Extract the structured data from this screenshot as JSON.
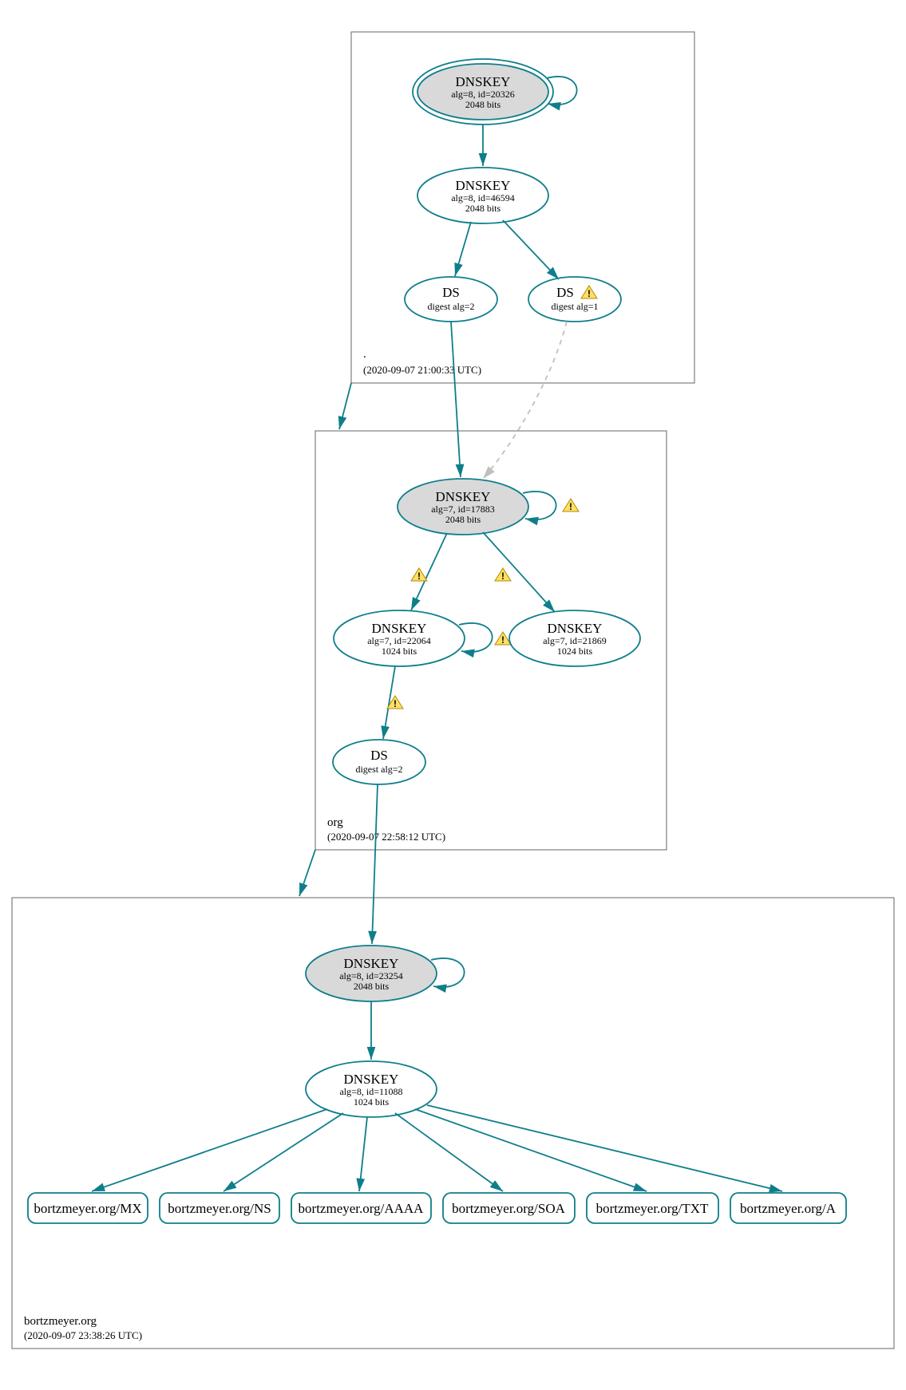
{
  "zones": {
    "root": {
      "name": ".",
      "timestamp": "(2020-09-07 21:00:33 UTC)"
    },
    "org": {
      "name": "org",
      "timestamp": "(2020-09-07 22:58:12 UTC)"
    },
    "bortz": {
      "name": "bortzmeyer.org",
      "timestamp": "(2020-09-07 23:38:26 UTC)"
    }
  },
  "nodes": {
    "root_ksk": {
      "title": "DNSKEY",
      "sub1": "alg=8, id=20326",
      "sub2": "2048 bits"
    },
    "root_zsk": {
      "title": "DNSKEY",
      "sub1": "alg=8, id=46594",
      "sub2": "2048 bits"
    },
    "root_ds1": {
      "title": "DS",
      "sub1": "digest alg=2"
    },
    "root_ds2": {
      "title": "DS",
      "sub1": "digest alg=1"
    },
    "org_ksk": {
      "title": "DNSKEY",
      "sub1": "alg=7, id=17883",
      "sub2": "2048 bits"
    },
    "org_zsk1": {
      "title": "DNSKEY",
      "sub1": "alg=7, id=22064",
      "sub2": "1024 bits"
    },
    "org_zsk2": {
      "title": "DNSKEY",
      "sub1": "alg=7, id=21869",
      "sub2": "1024 bits"
    },
    "org_ds": {
      "title": "DS",
      "sub1": "digest alg=2"
    },
    "bortz_ksk": {
      "title": "DNSKEY",
      "sub1": "alg=8, id=23254",
      "sub2": "2048 bits"
    },
    "bortz_zsk": {
      "title": "DNSKEY",
      "sub1": "alg=8, id=11088",
      "sub2": "1024 bits"
    }
  },
  "rrsets": {
    "mx": "bortzmeyer.org/MX",
    "ns": "bortzmeyer.org/NS",
    "aaaa": "bortzmeyer.org/AAAA",
    "soa": "bortzmeyer.org/SOA",
    "txt": "bortzmeyer.org/TXT",
    "a": "bortzmeyer.org/A"
  }
}
